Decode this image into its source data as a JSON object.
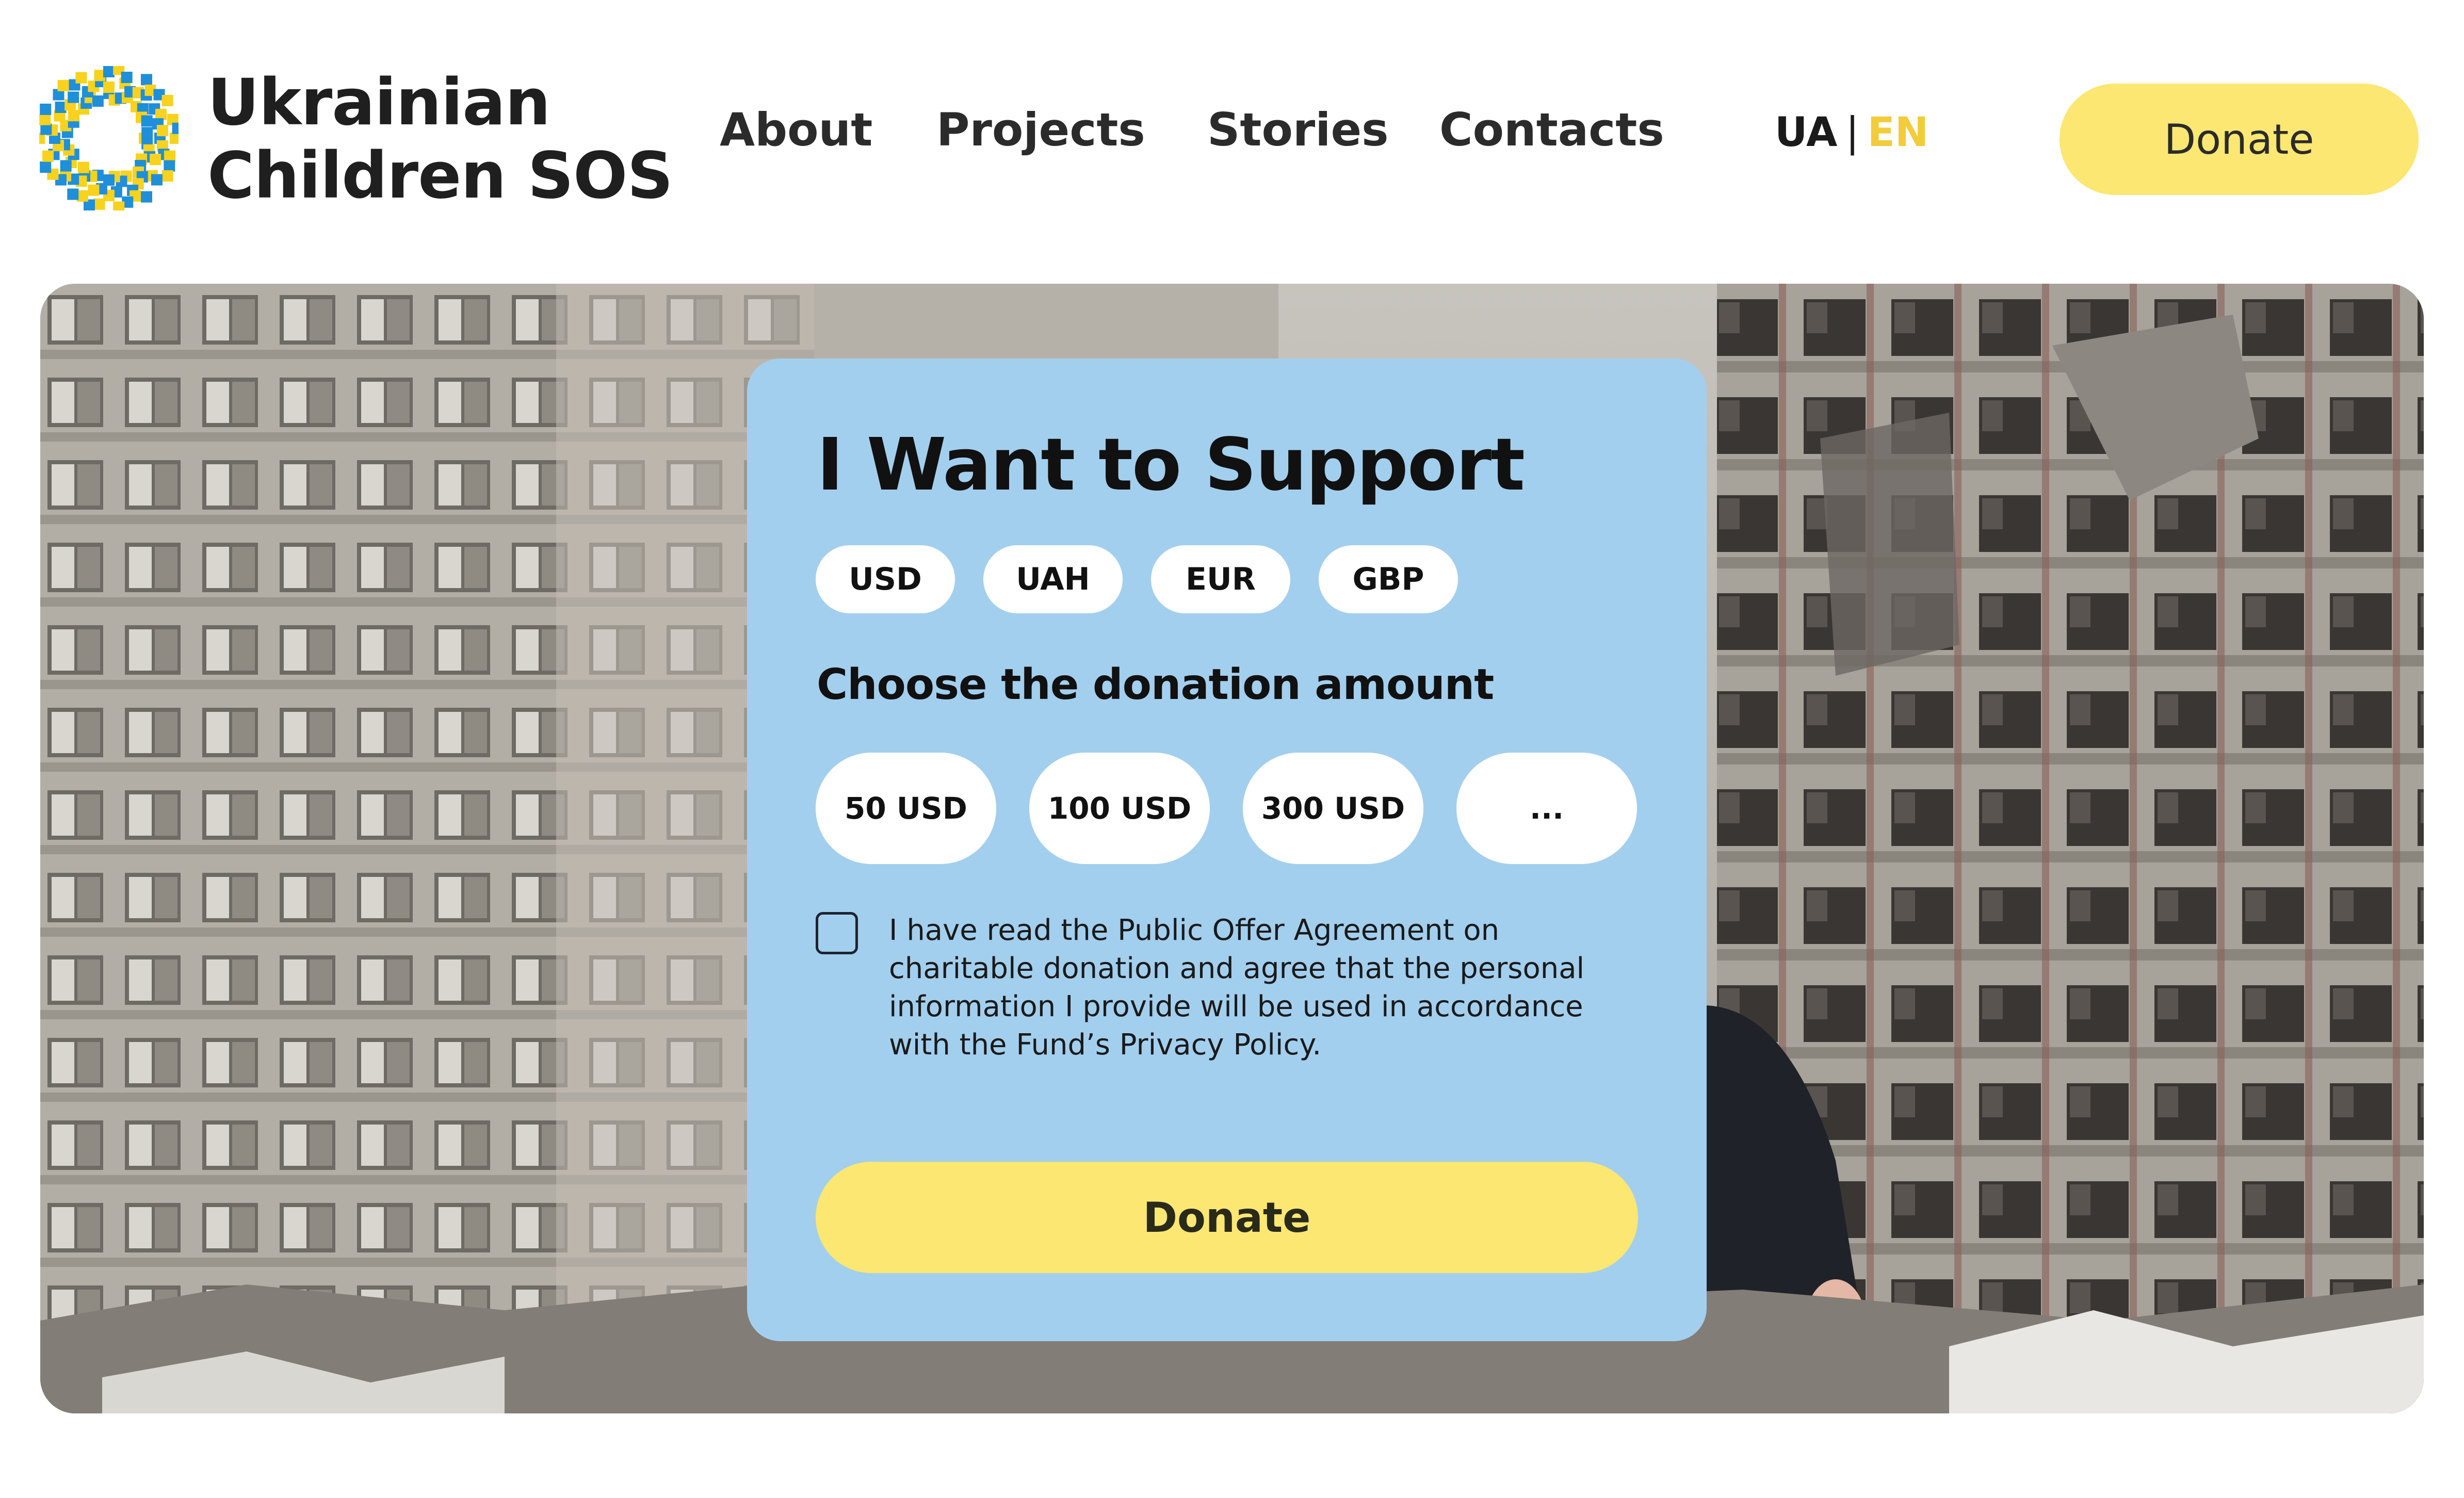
{
  "brand": {
    "line1": "Ukrainian",
    "line2": "Children SOS",
    "logo_icon": "pixel-wreath-logo"
  },
  "nav": [
    {
      "label": "About"
    },
    {
      "label": "Projects"
    },
    {
      "label": "Stories"
    },
    {
      "label": "Contacts"
    }
  ],
  "language": {
    "ua": "UA",
    "separator": "|",
    "en": "EN",
    "active": "EN"
  },
  "header": {
    "donate_label": "Donate"
  },
  "form": {
    "title": "I Want to Support",
    "currencies": [
      "USD",
      "UAH",
      "EUR",
      "GBP"
    ],
    "amount_heading": "Choose the donation amount",
    "amounts": [
      "50 USD",
      "100 USD",
      "300 USD",
      "..."
    ],
    "agreement_text": "I have read the Public Offer Agreement on charitable donation and agree that the personal information I provide will be used in accordance with the Fund’s Privacy Policy.",
    "agreement_checked": false,
    "donate_label": "Donate"
  },
  "colors": {
    "accent_yellow": "#fbe772",
    "lang_active": "#f2cc3a",
    "card_blue": "#a3cfee",
    "logo_blue": "#1f8fd9",
    "logo_yellow": "#f8d21c"
  }
}
